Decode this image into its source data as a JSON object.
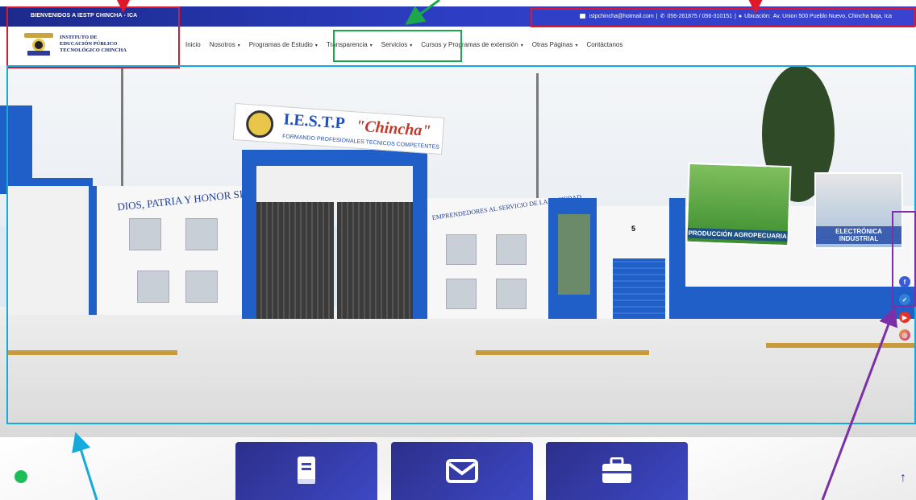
{
  "topbar": {
    "welcome": "BIENVENIDOS A IESTP CHINCHA - ICA",
    "email": "istpchincha@hotmail.com",
    "phones": "056-261875 / 056-310151",
    "location_label": "Ubicación:",
    "address": "Av. Union 500 Pueblo Nuevo, Chincha baja, Ica"
  },
  "logo": {
    "line1": "INSTITUTO DE",
    "line2": "EDUCACIÓN PÚBLICO",
    "line3": "TECNOLÓGICO CHINCHA"
  },
  "nav": {
    "items": [
      {
        "label": "Inicio",
        "dropdown": false
      },
      {
        "label": "Nosotros",
        "dropdown": true
      },
      {
        "label": "Programas de Estudio",
        "dropdown": true
      },
      {
        "label": "Transparencia",
        "dropdown": true
      },
      {
        "label": "Servicios",
        "dropdown": true
      },
      {
        "label": "Cursos y Programas de extensión",
        "dropdown": true
      },
      {
        "label": "Otras Páginas",
        "dropdown": true
      },
      {
        "label": "Contáctanos",
        "dropdown": false
      }
    ]
  },
  "hero": {
    "sign_title": "I.E.S.T.P",
    "sign_name": "\"Chincha\"",
    "sign_sub": "FORMANDO PROFESIONALES TECNICOS COMPETENTES",
    "arch_left": "DIOS, PATRIA Y HONOR SIEMPRE",
    "arch_right": "EMPRENDEDORES AL SERVICIO DE LA SOCIEDAD",
    "billboard_1": "PRODUCCIÓN AGROPECUARIA",
    "billboard_2": "ELECTRÓNICA INDUSTRIAL",
    "door_number": "5"
  },
  "social": [
    "facebook-icon",
    "twitter-icon",
    "youtube-icon",
    "instagram-icon"
  ],
  "cards": [
    "book-icon",
    "mail-icon",
    "briefcase-icon"
  ],
  "colors": {
    "topbar": "#2d3ec4",
    "brand_blue": "#1f5fc7",
    "annotation_red": "#e0182b",
    "annotation_green": "#1aa84a",
    "annotation_cyan": "#16a9dc",
    "annotation_purple": "#7b2fa8"
  }
}
